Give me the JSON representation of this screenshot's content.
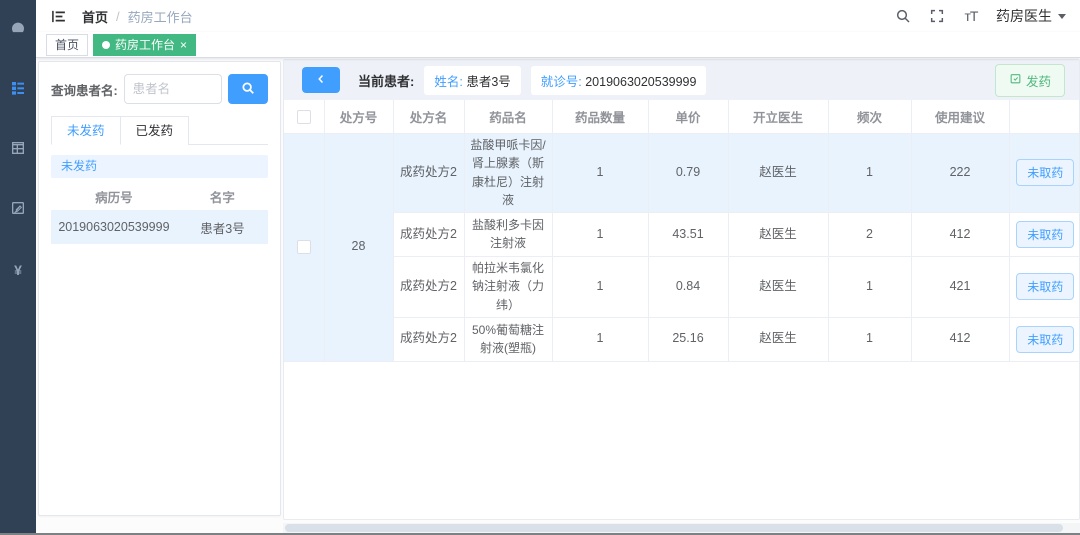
{
  "app": {
    "breadcrumb": {
      "home": "首页",
      "separator": "/",
      "current": "药房工作台"
    },
    "navbar": {
      "user_name": "药房医生",
      "font_size_glyph": "тT"
    },
    "tags": [
      {
        "label": "首页"
      },
      {
        "label": "药房工作台",
        "close_glyph": "×"
      }
    ]
  },
  "sidebar": {
    "money_glyph": "¥",
    "items": [
      "dashboard",
      "tree-menu",
      "table",
      "edit",
      "money"
    ]
  },
  "left_panel": {
    "search_label": "查询患者名:",
    "search_placeholder": "患者名",
    "tabs": [
      {
        "label": "未发药",
        "active": true
      },
      {
        "label": "已发药",
        "active": false
      }
    ],
    "section_title": "未发药",
    "list": {
      "headers": [
        "病历号",
        "名字"
      ],
      "rows": [
        {
          "record_no": "2019063020539999",
          "name": "患者3号"
        }
      ]
    }
  },
  "right_panel": {
    "current_patient_label": "当前患者:",
    "name_label": "姓名:",
    "name_value": "患者3号",
    "visit_label": "就诊号:",
    "visit_value": "2019063020539999",
    "dispense_button": "发药",
    "table": {
      "headers": [
        "处方号",
        "处方名",
        "药品名",
        "药品数量",
        "单价",
        "开立医生",
        "频次",
        "使用建议"
      ],
      "prescription_no": "28",
      "rows": [
        {
          "type": "成药处方2",
          "drug": "盐酸甲哌卡因/肾上腺素（斯康杜尼）注射液",
          "qty": "1",
          "price": "0.79",
          "doctor": "赵医生",
          "freq": "1",
          "advice": "222",
          "status": "未取药"
        },
        {
          "type": "成药处方2",
          "drug": "盐酸利多卡因注射液",
          "qty": "1",
          "price": "43.51",
          "doctor": "赵医生",
          "freq": "2",
          "advice": "412",
          "status": "未取药"
        },
        {
          "type": "成药处方2",
          "drug": "帕拉米韦氯化钠注射液（力纬）",
          "qty": "1",
          "price": "0.84",
          "doctor": "赵医生",
          "freq": "1",
          "advice": "421",
          "status": "未取药"
        },
        {
          "type": "成药处方2",
          "drug": "50%葡萄糖注射液(塑瓶)",
          "qty": "1",
          "price": "25.16",
          "doctor": "赵医生",
          "freq": "1",
          "advice": "412",
          "status": "未取药"
        }
      ]
    }
  },
  "colors": {
    "sidebar_bg": "#304156",
    "primary_blue": "#409eff",
    "active_tag_green": "#42b983",
    "row_highlight": "#e8f3fd",
    "success_green": "#52b87e"
  }
}
